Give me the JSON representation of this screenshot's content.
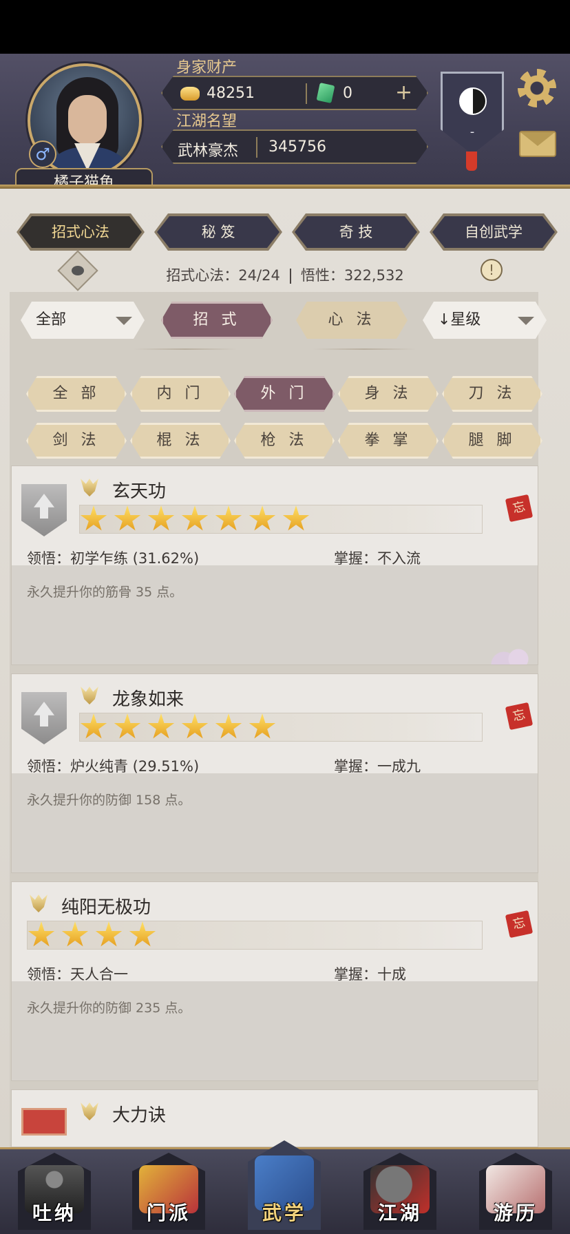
{
  "header": {
    "player_name": "橘子猫鱼",
    "gender_symbol": "♂",
    "wealth_label": "身家财产",
    "gold_value": "48251",
    "jade_value": "0",
    "add_symbol": "+",
    "fame_label": "江湖名望",
    "fame_title": "武林豪杰",
    "fame_value": "345756",
    "emblem_text": "-"
  },
  "tabs": [
    {
      "label": "招式心法",
      "active": true
    },
    {
      "label": "秘 笈",
      "active": false
    },
    {
      "label": "奇 技",
      "active": false
    },
    {
      "label": "自创武学",
      "active": false
    }
  ],
  "stats": {
    "moves_label": "招式心法：24/24",
    "insight_label": "悟性：322,532"
  },
  "filters": {
    "scope_select": "全部",
    "type_moves": "招 式",
    "type_mind": "心 法",
    "sort_select": "↓星级"
  },
  "categories": [
    "全 部",
    "内 门",
    "外 门",
    "身 法",
    "刀 法",
    "剑 法",
    "棍 法",
    "枪 法",
    "拳 掌",
    "腿 脚"
  ],
  "active_category": "外 门",
  "skills": [
    {
      "name": "玄天功",
      "stars": 7,
      "insight": "领悟：初学乍练 (31.62%)",
      "mastery": "掌握：不入流",
      "desc": "永久提升你的筋骨 35 点。",
      "forget": "忘"
    },
    {
      "name": "龙象如来",
      "stars": 6,
      "insight": "领悟：炉火纯青 (29.51%)",
      "mastery": "掌握：一成九",
      "desc": "永久提升你的防御 158 点。",
      "forget": "忘"
    },
    {
      "name": "纯阳无极功",
      "stars": 4,
      "insight": "领悟：天人合一",
      "mastery": "掌握：十成",
      "desc": "永久提升你的防御 235 点。",
      "forget": "忘"
    },
    {
      "name": "大力诀",
      "stars": 0,
      "insight": "",
      "mastery": "",
      "desc": "",
      "forget": ""
    }
  ],
  "bottom_nav": [
    {
      "label": "吐纳",
      "active": false
    },
    {
      "label": "门派",
      "active": false
    },
    {
      "label": "武学",
      "active": true
    },
    {
      "label": "江湖",
      "active": false
    },
    {
      "label": "游历",
      "active": false
    }
  ],
  "colors": {
    "accent_active": "#7e5b67",
    "gold_text": "#e7c98f",
    "header_bg": "#444257"
  }
}
